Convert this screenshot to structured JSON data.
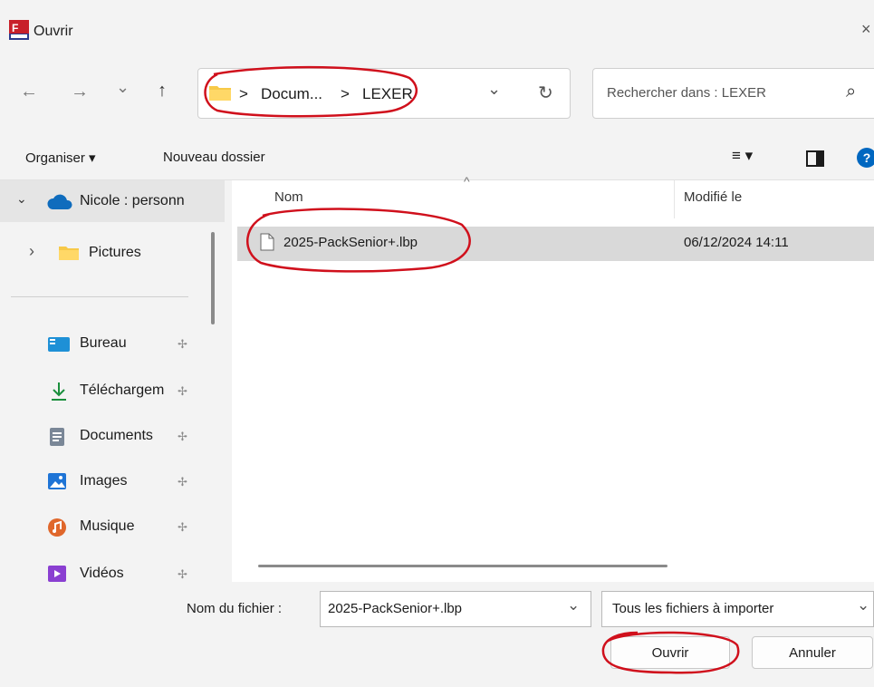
{
  "window": {
    "title": "Ouvrir",
    "close_glyph": "×"
  },
  "nav": {
    "back_glyph": "←",
    "forward_glyph": "→",
    "recent_glyph": "⌄",
    "up_glyph": "↑",
    "breadcrumb": [
      "Docum...",
      "LEXER"
    ],
    "crumb_sep": ">",
    "dropdown_glyph": "⌄",
    "refresh_glyph": "↻",
    "search_placeholder": "Rechercher dans : LEXER",
    "search_glyph": "⌕"
  },
  "toolbar": {
    "organize_label": "Organiser ▾",
    "new_folder_label": "Nouveau dossier",
    "view_glyph": "≡ ▾",
    "help_glyph": "?"
  },
  "sidebar": {
    "items": [
      {
        "label": "Nicole : personn",
        "icon": "cloud-icon",
        "chevron": "⌄"
      },
      {
        "label": "Pictures",
        "icon": "folder-icon",
        "chevron": "›"
      },
      {
        "label": "Bureau",
        "icon": "desktop-icon",
        "pinned": true
      },
      {
        "label": "Téléchargem",
        "icon": "download-icon",
        "pinned": true
      },
      {
        "label": "Documents",
        "icon": "documents-icon",
        "pinned": true
      },
      {
        "label": "Images",
        "icon": "images-icon",
        "pinned": true
      },
      {
        "label": "Musique",
        "icon": "music-icon",
        "pinned": true
      },
      {
        "label": "Vidéos",
        "icon": "videos-icon",
        "pinned": true
      }
    ],
    "pin_glyph": "✢"
  },
  "file_list": {
    "sort_glyph": "^",
    "columns": [
      "Nom",
      "Modifié le"
    ],
    "rows": [
      {
        "name": "2025-PackSenior+.lbp",
        "modified": "06/12/2024 14:11"
      }
    ]
  },
  "footer": {
    "file_name_label": "Nom du fichier :",
    "file_name_value": "2025-PackSenior+.lbp",
    "filter_value": "Tous les fichiers à importer",
    "dropdown_glyph": "⌄",
    "open_label": "Ouvrir",
    "cancel_label": "Annuler"
  },
  "colors": {
    "annotation": "#d0101c",
    "accent": "#0067c0",
    "selection": "#d9d9d9"
  }
}
